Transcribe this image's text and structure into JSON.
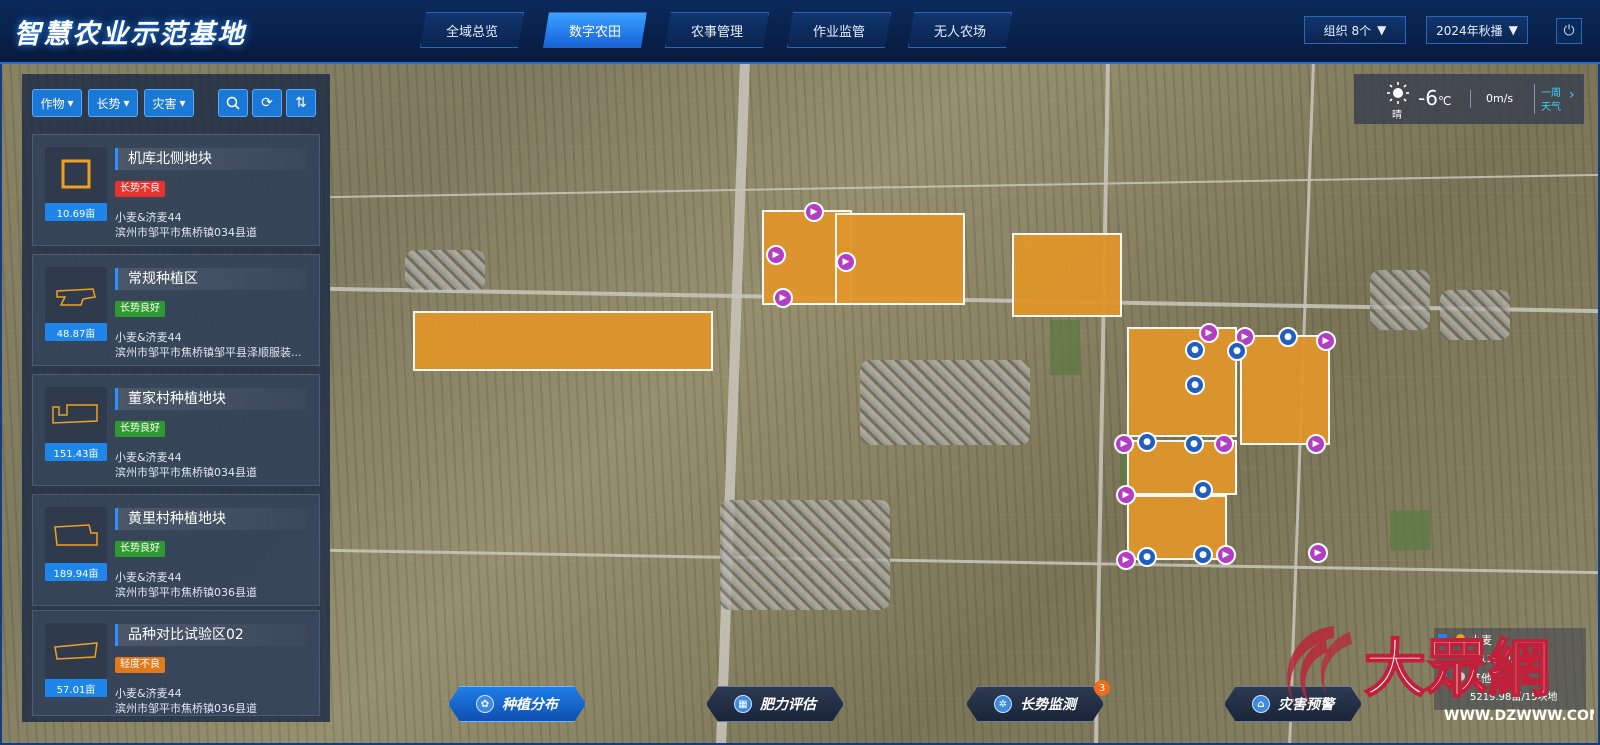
{
  "header": {
    "title": "智慧农业示范基地",
    "nav": [
      {
        "label": "全域总览"
      },
      {
        "label": "数字农田"
      },
      {
        "label": "农事管理"
      },
      {
        "label": "作业监管"
      },
      {
        "label": "无人农场"
      }
    ],
    "org_select": "组织 8个",
    "season_select": "2024年秋播",
    "power_icon": "power-icon",
    "colors": {
      "accent": "#1e86ea",
      "header_bg": "#071a3d",
      "active_nav": "#1763d8"
    }
  },
  "filters": {
    "crop": "作物",
    "growth": "长势",
    "disaster": "灾害",
    "tools": [
      "search-icon",
      "refresh-icon",
      "sort-icon"
    ]
  },
  "plots": [
    {
      "name": "机库北侧地块",
      "status": "长势不良",
      "status_color": "#e8332d",
      "area": "10.69亩",
      "crop": "小麦&济麦44",
      "address": "滨州市邹平市焦桥镇034县道"
    },
    {
      "name": "常规种植区",
      "status": "长势良好",
      "status_color": "#2f9a2f",
      "area": "48.87亩",
      "crop": "小麦&济麦44",
      "address": "滨州市邹平市焦桥镇邹平县泽顺服装..."
    },
    {
      "name": "董家村种植地块",
      "status": "长势良好",
      "status_color": "#2f9a2f",
      "area": "151.43亩",
      "crop": "小麦&济麦44",
      "address": "滨州市邹平市焦桥镇034县道"
    },
    {
      "name": "黄里村种植地块",
      "status": "长势良好",
      "status_color": "#2f9a2f",
      "area": "189.94亩",
      "crop": "小麦&济麦44",
      "address": "滨州市邹平市焦桥镇036县道"
    },
    {
      "name": "品种对比试验区02",
      "status": "轻度不良",
      "status_color": "#e07a1a",
      "area": "57.01亩",
      "crop": "小麦&济麦44",
      "address": "滨州市邹平市焦桥镇036县道"
    }
  ],
  "weather": {
    "condition": "晴",
    "temperature": "-6",
    "unit": "℃",
    "wind": "0m/s",
    "week_link_line1": "一周",
    "week_link_line2": "天气"
  },
  "bottom_tabs": [
    {
      "label": "种植分布"
    },
    {
      "label": "肥力评估"
    },
    {
      "label": "长势监测",
      "badge": "3"
    },
    {
      "label": "灾害预警"
    }
  ],
  "legend": {
    "items": [
      {
        "label": "小麦",
        "value": "…11亩/1…",
        "color": "#f0a020"
      },
      {
        "label": "其他",
        "value": "5219.98亩/15块地",
        "color": "#cccccc"
      }
    ]
  },
  "watermark": {
    "brand": "大眾網",
    "url": "WWW.DZWWW.COM"
  }
}
